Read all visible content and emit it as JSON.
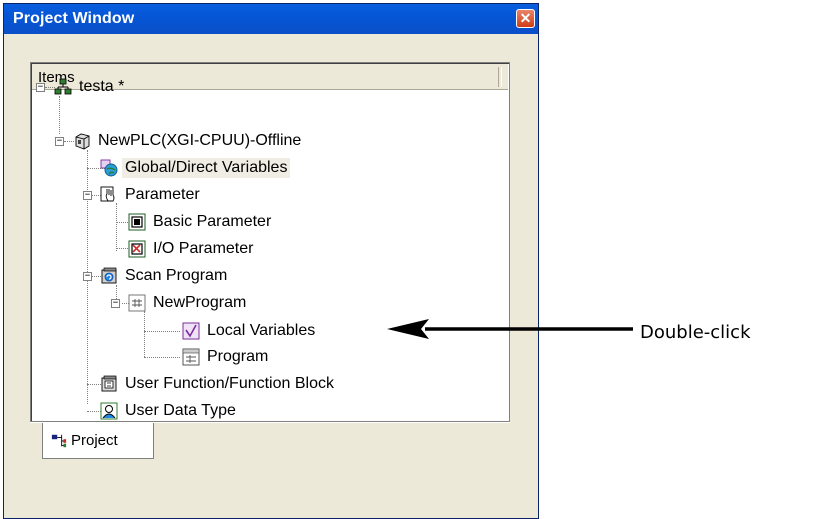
{
  "window": {
    "title": "Project Window",
    "close_label": "✕"
  },
  "tree_header": {
    "label": "Items"
  },
  "tree": [
    {
      "label": "testa *",
      "icon": "project-root-icon"
    },
    {
      "label": "NewPLC(XGI-CPUU)-Offline",
      "icon": "plc-icon"
    },
    {
      "label": "Global/Direct Variables",
      "icon": "global-variables-icon",
      "selected": true
    },
    {
      "label": "Parameter",
      "icon": "parameter-icon"
    },
    {
      "label": "Basic Parameter",
      "icon": "basic-parameter-icon"
    },
    {
      "label": "I/O Parameter",
      "icon": "io-parameter-icon"
    },
    {
      "label": "Scan Program",
      "icon": "scan-program-icon"
    },
    {
      "label": "NewProgram",
      "icon": "program-icon"
    },
    {
      "label": "Local Variables",
      "icon": "local-variables-icon"
    },
    {
      "label": "Program",
      "icon": "program-body-icon"
    },
    {
      "label": "User Function/Function Block",
      "icon": "user-function-icon"
    },
    {
      "label": "User Data Type",
      "icon": "user-data-type-icon"
    }
  ],
  "tabs": [
    {
      "label": "Project",
      "icon": "project-tab-icon"
    }
  ],
  "annotation": {
    "text": "Double-click"
  },
  "colors": {
    "titlebar": "#0556d6",
    "window_bg": "#ece9d8",
    "accent": "#000000"
  }
}
